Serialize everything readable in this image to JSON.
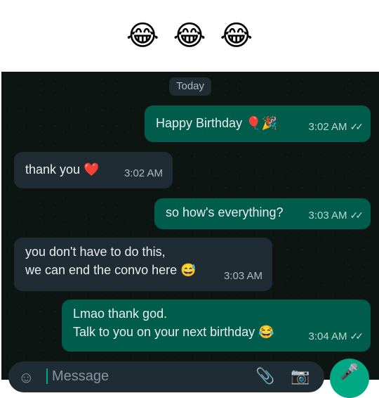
{
  "caption": {
    "emojis": [
      "😂",
      "😂",
      "😂"
    ]
  },
  "chat": {
    "date_label": "Today",
    "messages": [
      {
        "direction": "out",
        "lines": [
          "Happy Birthday 🎈🎉"
        ],
        "time": "3:02 AM",
        "ticks": "✓✓"
      },
      {
        "direction": "in",
        "lines": [
          "thank you ❤️"
        ],
        "time": "3:02 AM"
      },
      {
        "direction": "out",
        "lines": [
          "so how's everything?"
        ],
        "time": "3:03 AM",
        "ticks": "✓✓"
      },
      {
        "direction": "in",
        "lines": [
          "you don't have to do this,",
          "we can end the convo here 😅"
        ],
        "time": "3:03 AM"
      },
      {
        "direction": "out",
        "lines": [
          "Lmao thank god.",
          "Talk to you on your next birthday 😂"
        ],
        "time": "3:04 AM",
        "ticks": "✓✓"
      }
    ]
  },
  "composer": {
    "placeholder": "Message",
    "icons": [
      "emoji-icon",
      "attach-icon",
      "camera-icon",
      "mic-icon"
    ]
  }
}
